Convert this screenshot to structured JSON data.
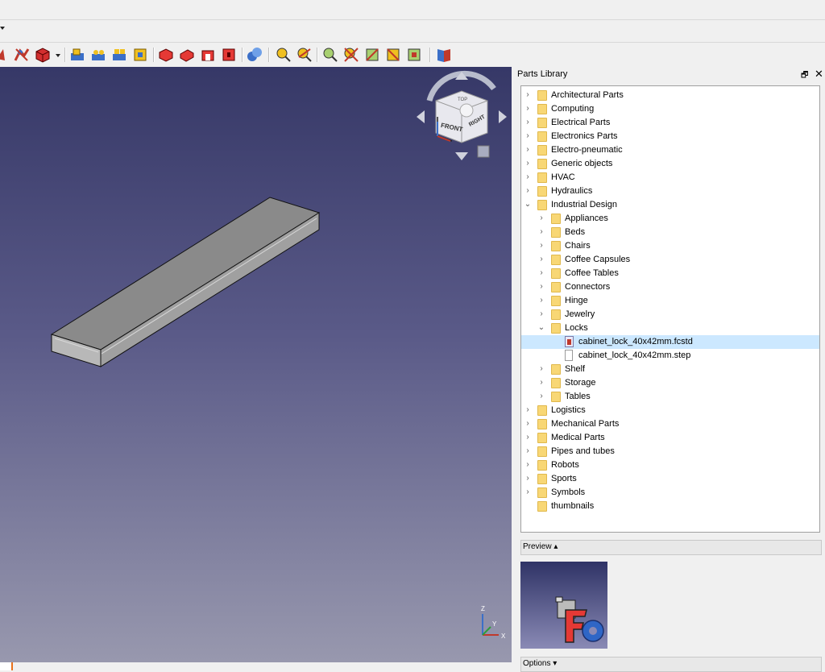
{
  "panel": {
    "title": "Parts Library",
    "float_glyph": "🗗",
    "close_glyph": "✕"
  },
  "tree": [
    {
      "label": "Architectural Parts",
      "level": 0,
      "expanded": false,
      "kind": "folder"
    },
    {
      "label": "Computing",
      "level": 0,
      "expanded": false,
      "kind": "folder"
    },
    {
      "label": "Electrical Parts",
      "level": 0,
      "expanded": false,
      "kind": "folder"
    },
    {
      "label": "Electronics Parts",
      "level": 0,
      "expanded": false,
      "kind": "folder"
    },
    {
      "label": "Electro-pneumatic",
      "level": 0,
      "expanded": false,
      "kind": "folder"
    },
    {
      "label": "Generic objects",
      "level": 0,
      "expanded": false,
      "kind": "folder"
    },
    {
      "label": "HVAC",
      "level": 0,
      "expanded": false,
      "kind": "folder"
    },
    {
      "label": "Hydraulics",
      "level": 0,
      "expanded": false,
      "kind": "folder"
    },
    {
      "label": "Industrial Design",
      "level": 0,
      "expanded": true,
      "kind": "folder"
    },
    {
      "label": "Appliances",
      "level": 1,
      "expanded": false,
      "kind": "folder"
    },
    {
      "label": "Beds",
      "level": 1,
      "expanded": false,
      "kind": "folder"
    },
    {
      "label": "Chairs",
      "level": 1,
      "expanded": false,
      "kind": "folder"
    },
    {
      "label": "Coffee Capsules",
      "level": 1,
      "expanded": false,
      "kind": "folder"
    },
    {
      "label": "Coffee Tables",
      "level": 1,
      "expanded": false,
      "kind": "folder"
    },
    {
      "label": "Connectors",
      "level": 1,
      "expanded": false,
      "kind": "folder"
    },
    {
      "label": "Hinge",
      "level": 1,
      "expanded": false,
      "kind": "folder"
    },
    {
      "label": "Jewelry",
      "level": 1,
      "expanded": false,
      "kind": "folder"
    },
    {
      "label": "Locks",
      "level": 1,
      "expanded": true,
      "kind": "folder"
    },
    {
      "label": "cabinet_lock_40x42mm.fcstd",
      "level": 2,
      "kind": "fcstd",
      "selected": true
    },
    {
      "label": "cabinet_lock_40x42mm.step",
      "level": 2,
      "kind": "file"
    },
    {
      "label": "Shelf",
      "level": 1,
      "expanded": false,
      "kind": "folder"
    },
    {
      "label": "Storage",
      "level": 1,
      "expanded": false,
      "kind": "folder"
    },
    {
      "label": "Tables",
      "level": 1,
      "expanded": false,
      "kind": "folder"
    },
    {
      "label": "Logistics",
      "level": 0,
      "expanded": false,
      "kind": "folder"
    },
    {
      "label": "Mechanical Parts",
      "level": 0,
      "expanded": false,
      "kind": "folder"
    },
    {
      "label": "Medical Parts",
      "level": 0,
      "expanded": false,
      "kind": "folder"
    },
    {
      "label": "Pipes and tubes",
      "level": 0,
      "expanded": false,
      "kind": "folder"
    },
    {
      "label": "Robots",
      "level": 0,
      "expanded": false,
      "kind": "folder"
    },
    {
      "label": "Sports",
      "level": 0,
      "expanded": false,
      "kind": "folder"
    },
    {
      "label": "Symbols",
      "level": 0,
      "expanded": false,
      "kind": "folder"
    },
    {
      "label": "thumbnails",
      "level": 0,
      "kind": "folder",
      "leaf": true
    }
  ],
  "preview_section": {
    "label": "Preview ▴"
  },
  "options_section": {
    "label": "Options ▾"
  },
  "navcube": {
    "front": "FRONT",
    "right": "RIGHT",
    "top": "TOP"
  },
  "axis": {
    "z": "Z",
    "y": "Y",
    "x": "X"
  },
  "colors": {
    "selection": "#cce8ff",
    "folder": "#f8d775",
    "accent": "#e8711b"
  },
  "toolbar_icons": [
    "view-icon",
    "sketch-icon",
    "part-box-icon",
    "dropdown-arrow",
    "assembly-1-icon",
    "assembly-2-icon",
    "assembly-3-icon",
    "assembly-4-icon",
    "solid-front-icon",
    "solid-top-icon",
    "solid-right-icon",
    "solid-rear-icon",
    "link-icon",
    "measure-1-icon",
    "measure-2-icon",
    "measure-3-icon",
    "measure-4-icon",
    "measure-5-icon",
    "measure-6-icon",
    "measure-7-icon",
    "book-icon"
  ]
}
